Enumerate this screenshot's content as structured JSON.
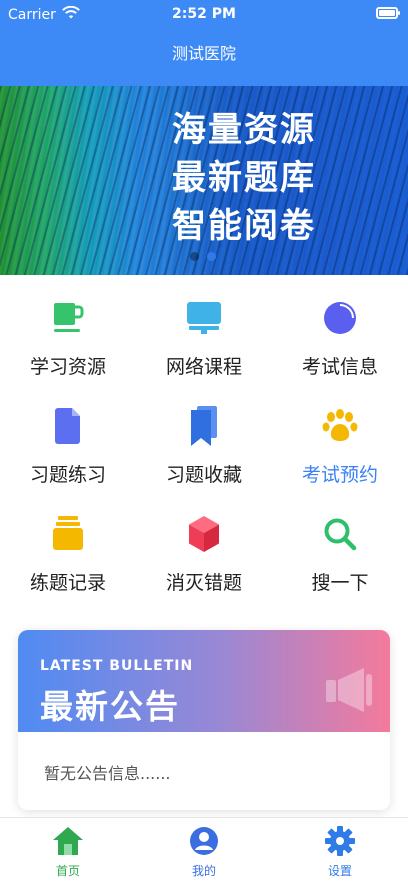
{
  "status_bar": {
    "carrier": "Carrier",
    "time": "2:52 PM"
  },
  "nav": {
    "title": "测试医院"
  },
  "banner": {
    "lines": [
      "海量资源",
      "最新题库",
      "智能阅卷"
    ],
    "active_dot": 1
  },
  "menu": [
    {
      "label": "学习资源",
      "icon": "cup-icon",
      "color": "#35c36b"
    },
    {
      "label": "网络课程",
      "icon": "monitor-icon",
      "color": "#3fb2e8"
    },
    {
      "label": "考试信息",
      "icon": "pie-chart-icon",
      "color": "#5b5ff0"
    },
    {
      "label": "习题练习",
      "icon": "document-icon",
      "color": "#5b6ff0"
    },
    {
      "label": "习题收藏",
      "icon": "bookmark-icon",
      "color": "#2f6fe0"
    },
    {
      "label": "考试预约",
      "icon": "paw-icon",
      "color": "#f5b800",
      "highlight": true
    },
    {
      "label": "练题记录",
      "icon": "stack-icon",
      "color": "#f5b800"
    },
    {
      "label": "消灭错题",
      "icon": "cube-icon",
      "color": "#ef3d57"
    },
    {
      "label": "搜一下",
      "icon": "search-icon",
      "color": "#2fbf6a"
    }
  ],
  "bulletin": {
    "subtitle": "LATEST BULLETIN",
    "title": "最新公告",
    "empty_text": "暂无公告信息......"
  },
  "tabs": [
    {
      "label": "首页",
      "icon": "home-icon",
      "color": "#2fa84f"
    },
    {
      "label": "我的",
      "icon": "user-icon",
      "color": "#3b6fe0"
    },
    {
      "label": "设置",
      "icon": "gear-icon",
      "color": "#2f7be8"
    }
  ]
}
